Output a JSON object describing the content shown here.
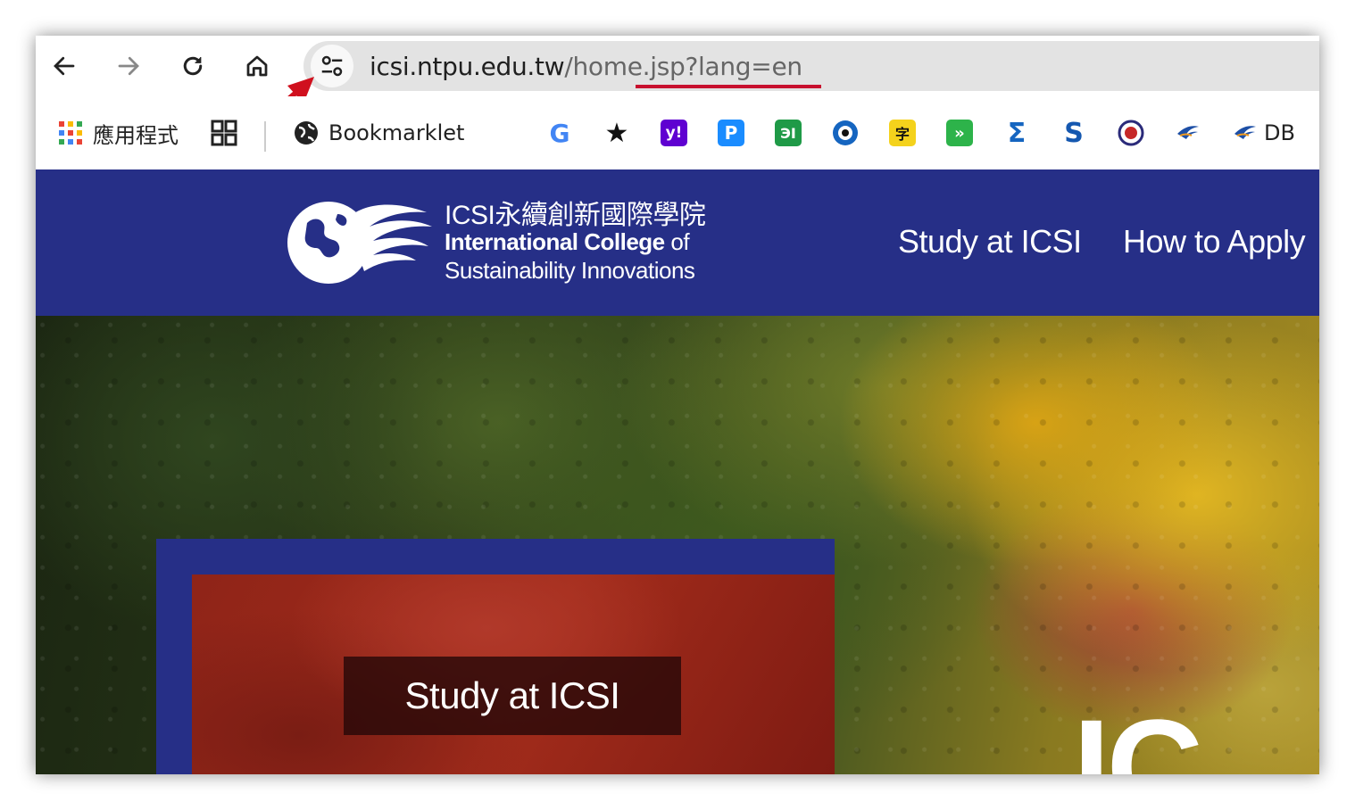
{
  "browser": {
    "url_domain": "icsi.ntpu.edu.tw",
    "url_path": "/home.jsp?lang=en",
    "accent_underline_color": "#c8102e",
    "arrow_color": "#d0101e"
  },
  "bookmarks": {
    "apps_label": "應用程式",
    "bookmarklet_label": "Bookmarklet",
    "last_label": "DB",
    "icons": [
      "google-icon",
      "star-icon",
      "yahoo-icon",
      "p-icon",
      "green-app-icon",
      "eye-icon",
      "dictionary-icon",
      "double-chevron-icon",
      "sigma-icon",
      "s-icon",
      "circle-logo-icon",
      "bird-icon",
      "bird-db-icon"
    ]
  },
  "site": {
    "header_color": "#262f87",
    "logo_title": "ICSI永續創新國際學院",
    "logo_line1_bold": "International College",
    "logo_line1_of": "of",
    "logo_line2": "Sustainability Innovations",
    "nav": [
      "Study at ICSI",
      "How to Apply"
    ]
  },
  "hero": {
    "card_label": "Study at ICSI",
    "big_text": "IC"
  }
}
